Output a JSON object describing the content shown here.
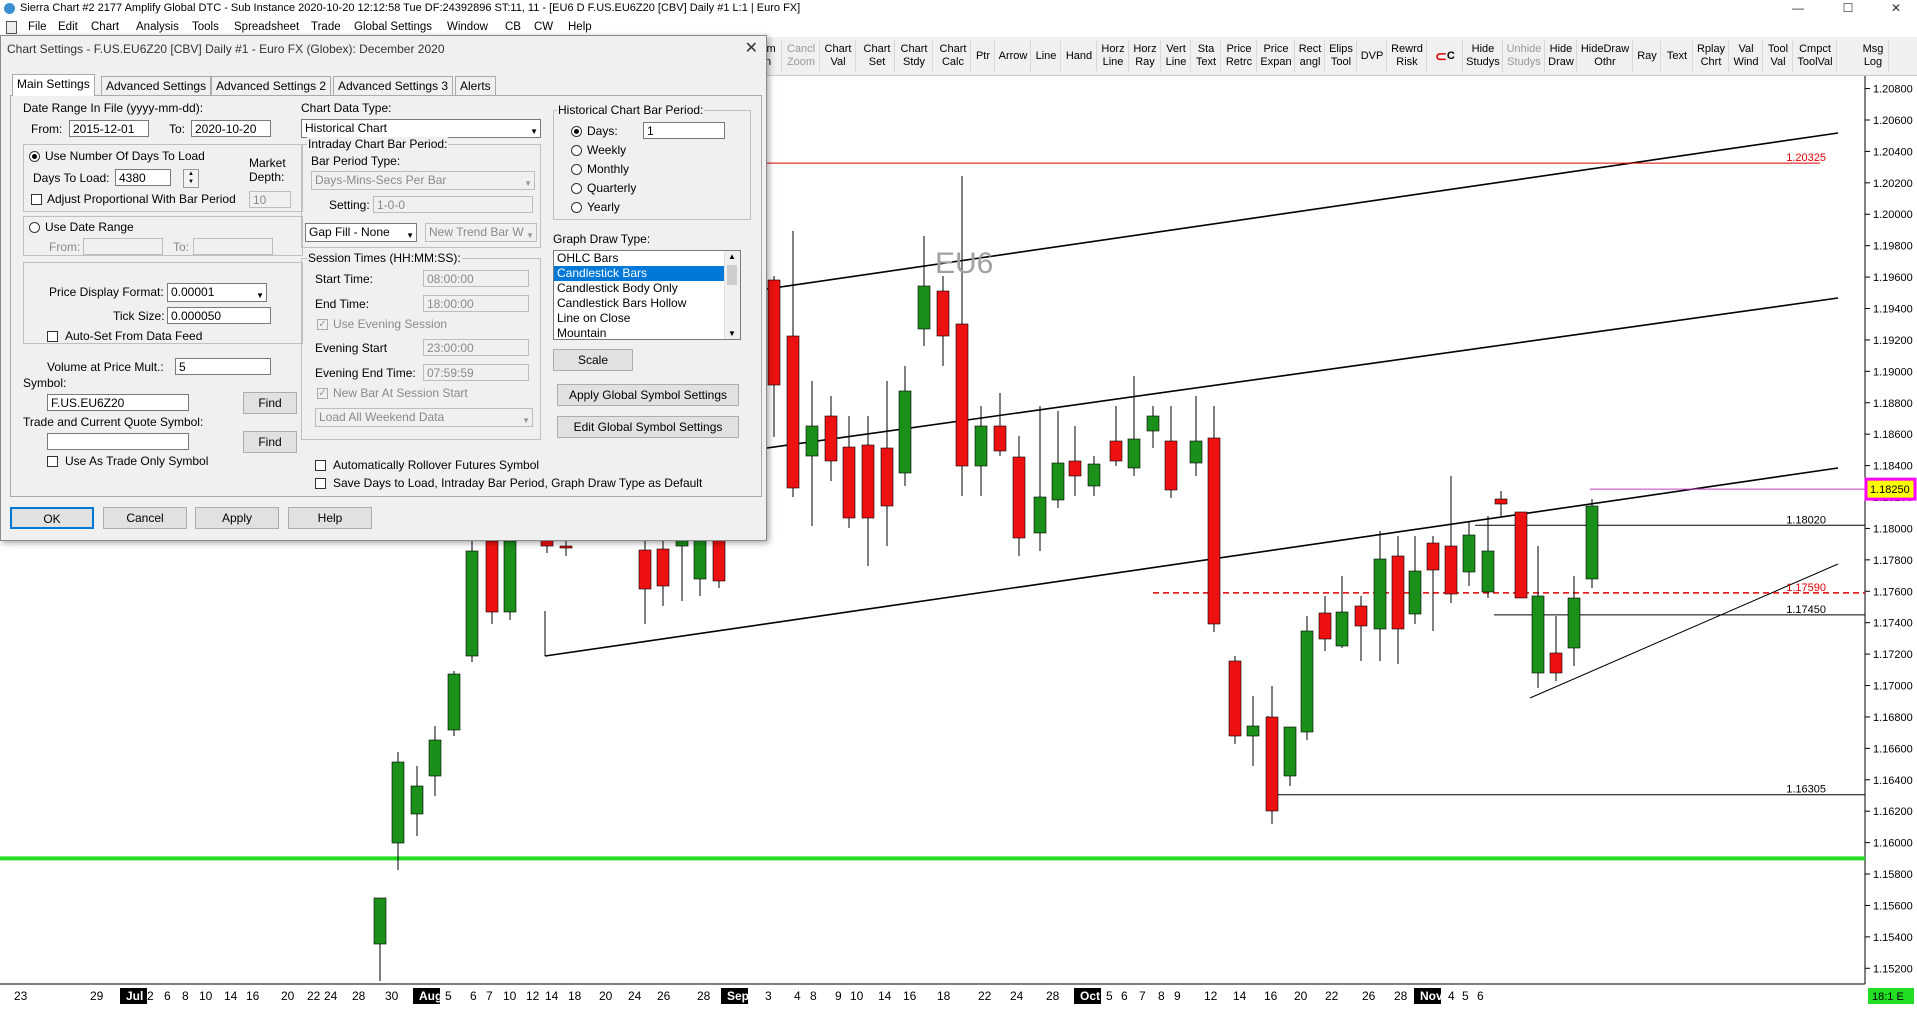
{
  "window": {
    "title": "Sierra Chart #2 2177 Amplify Global  DTC - Sub Instance 2020-10-20  12:12:58 Tue  DF:24392896  ST:11, 11 - [EU6 D  F.US.EU6Z20 [CBV]  Daily  #1  L:1 | Euro FX]",
    "minimize": "—",
    "maximize": "☐",
    "close": "✕"
  },
  "menu": [
    "File",
    "Edit",
    "Chart",
    "Analysis",
    "Tools",
    "Spreadsheet",
    "Trade",
    "Global Settings",
    "Window",
    "CB",
    "CW",
    "Help"
  ],
  "toolbar": [
    {
      "label": "om\nn",
      "dim": false
    },
    {
      "label": "Cancl\nZoom",
      "dim": true
    },
    {
      "label": "Chart\nVal",
      "dim": false
    },
    {
      "label": "Chart\nSet",
      "dim": false
    },
    {
      "label": "Chart\nStdy",
      "dim": false
    },
    {
      "label": "Chart\nCalc",
      "dim": false
    },
    {
      "label": "Ptr",
      "dim": false
    },
    {
      "label": "Arrow",
      "dim": false
    },
    {
      "label": "Line",
      "dim": false
    },
    {
      "label": "Hand",
      "dim": false
    },
    {
      "label": "Horz\nLine",
      "dim": false
    },
    {
      "label": "Horz\nRay",
      "dim": false
    },
    {
      "label": "Vert\nLine",
      "dim": false
    },
    {
      "label": "Sta\nText",
      "dim": false
    },
    {
      "label": "Price\nRetrc",
      "dim": false
    },
    {
      "label": "Price\nExpan",
      "dim": false
    },
    {
      "label": "Rect\nangl",
      "dim": false
    },
    {
      "label": "Elips\nTool",
      "dim": false
    },
    {
      "label": "DVP",
      "dim": false
    },
    {
      "label": "Rewrd\nRisk",
      "dim": false
    },
    {
      "label": "C",
      "dim": false
    },
    {
      "label": "Hide\nStudys",
      "dim": false
    },
    {
      "label": "Unhide\nStudys",
      "dim": true
    },
    {
      "label": "Hide\nDraw",
      "dim": false
    },
    {
      "label": "HideDraw\nOthr",
      "dim": false
    },
    {
      "label": "Ray",
      "dim": false
    },
    {
      "label": "Text",
      "dim": false
    },
    {
      "label": "Rplay\nChrt",
      "dim": false
    },
    {
      "label": "Val\nWind",
      "dim": false
    },
    {
      "label": "Tool\nVal",
      "dim": false
    },
    {
      "label": "Cmpct\nToolVal",
      "dim": false
    },
    {
      "label": "Msg\nLog",
      "dim": false
    }
  ],
  "chart": {
    "symbol_label": "EU6",
    "price_axis": [
      "1.20800",
      "1.20600",
      "1.20400",
      "1.20200",
      "1.20000",
      "1.19800",
      "1.19600",
      "1.19400",
      "1.19200",
      "1.19000",
      "1.18800",
      "1.18600",
      "1.18400",
      "1.18200",
      "1.18000",
      "1.17800",
      "1.17600",
      "1.17400",
      "1.17200",
      "1.17000",
      "1.16800",
      "1.16600",
      "1.16400",
      "1.16200",
      "1.16000",
      "1.15800",
      "1.15600",
      "1.15400",
      "1.15200"
    ],
    "price_range": [
      1.151,
      1.2088
    ],
    "levels": [
      {
        "label": "1.20325",
        "price": 1.20325,
        "color": "#e00000"
      },
      {
        "label": "1.18020",
        "price": 1.1802,
        "color": "#000000"
      },
      {
        "label": "1.17590",
        "price": 1.1759,
        "color": "#e00000"
      },
      {
        "label": "1.17450",
        "price": 1.1745,
        "color": "#000000"
      },
      {
        "label": "1.16305",
        "price": 1.16305,
        "color": "#000000"
      }
    ],
    "current_price": "1.18250",
    "current_price_value": 1.1825,
    "support_line_price": 1.159,
    "date_axis": [
      "23",
      "29",
      "Jul",
      "2",
      "6",
      "8",
      "10",
      "14",
      "16",
      "20",
      "22",
      "24",
      "28",
      "30",
      "Aug",
      "5",
      "6",
      "7",
      "10",
      "12",
      "14",
      "18",
      "20",
      "24",
      "26",
      "28",
      "Sep",
      "3",
      "4",
      "8",
      "9",
      "10",
      "14",
      "16",
      "18",
      "22",
      "24",
      "28",
      "Oct",
      "5",
      "6",
      "7",
      "8",
      "9",
      "12",
      "14",
      "16",
      "20",
      "22",
      "26",
      "28",
      "Nov",
      "4",
      "5",
      "6"
    ],
    "bottom_right": "18:1 E",
    "colors": {
      "up": "#1a8f1a",
      "down": "#ee1111",
      "support": "#22dd22",
      "price_marker_border": "#ff00ff",
      "price_marker_fill": "#ffff00"
    }
  },
  "dialog": {
    "title": "Chart Settings - F.US.EU6Z20 [CBV]  Daily  #1 - Euro FX (Globex): December 2020",
    "close": "✕",
    "tabs": [
      "Main Settings",
      "Advanced Settings",
      "Advanced Settings 2",
      "Advanced Settings 3",
      "Alerts"
    ],
    "date_range_label": "Date Range In File (yyyy-mm-dd):",
    "from_label": "From:",
    "from_value": "2015-12-01",
    "to_label": "To:",
    "to_value": "2020-10-20",
    "use_days_label": "Use Number Of Days To Load",
    "market_depth_label": "Market\nDepth:",
    "market_depth_value": "10",
    "days_to_load_label": "Days To Load:",
    "days_to_load_value": "4380",
    "adjust_label": "Adjust Proportional With Bar Period",
    "use_date_range_label": "Use Date Range",
    "dr_from_label": "From:",
    "dr_to_label": "To:",
    "price_format_label": "Price Display Format:",
    "price_format_value": "0.00001",
    "tick_size_label": "Tick Size:",
    "tick_size_value": "0.000050",
    "auto_set_label": "Auto-Set From Data Feed",
    "vap_label": "Volume at Price Mult.:",
    "vap_value": "5",
    "symbol_label": "Symbol:",
    "symbol_value": "F.US.EU6Z20",
    "find_label": "Find",
    "trade_symbol_label": "Trade and Current Quote Symbol:",
    "trade_symbol_value": "",
    "find2_label": "Find",
    "trade_only_label": "Use As Trade Only Symbol",
    "data_type_label": "Chart Data Type:",
    "data_type_value": "Historical Chart",
    "intraday_label": "Intraday Chart Bar Period:",
    "bar_period_type_label": "Bar Period Type:",
    "bar_period_type_value": "Days-Mins-Secs Per Bar",
    "setting_label": "Setting:",
    "setting_value": "1-0-0",
    "gap_fill_value": "Gap Fill - None",
    "new_trend_value": "New Trend Bar W",
    "session_label": "Session Times (HH:MM:SS):",
    "start_time_label": "Start Time:",
    "start_time_value": "08:00:00",
    "end_time_label": "End Time:",
    "end_time_value": "18:00:00",
    "evening_session_label": "Use Evening Session",
    "evening_start_label": "Evening Start",
    "evening_start_value": "23:00:00",
    "evening_end_label": "Evening End Time:",
    "evening_end_value": "07:59:59",
    "new_bar_label": "New Bar At Session Start",
    "weekend_value": "Load All Weekend Data",
    "rollover_label": "Automatically Rollover Futures Symbol",
    "save_days_label": "Save Days to Load, Intraday Bar Period, Graph Draw Type as Default",
    "hist_period_label": "Historical Chart Bar Period:",
    "days_label": "Days:",
    "days_value": "1",
    "weekly_label": "Weekly",
    "monthly_label": "Monthly",
    "quarterly_label": "Quarterly",
    "yearly_label": "Yearly",
    "draw_type_label": "Graph Draw Type:",
    "draw_types": [
      "OHLC Bars",
      "Candlestick Bars",
      "Candlestick Body Only",
      "Candlestick Bars Hollow",
      "Line on Close",
      "Mountain"
    ],
    "scale_label": "Scale",
    "apply_global_label": "Apply Global Symbol Settings",
    "edit_global_label": "Edit Global Symbol Settings",
    "ok_label": "OK",
    "cancel_label": "Cancel",
    "apply_label": "Apply",
    "help_label": "Help"
  }
}
